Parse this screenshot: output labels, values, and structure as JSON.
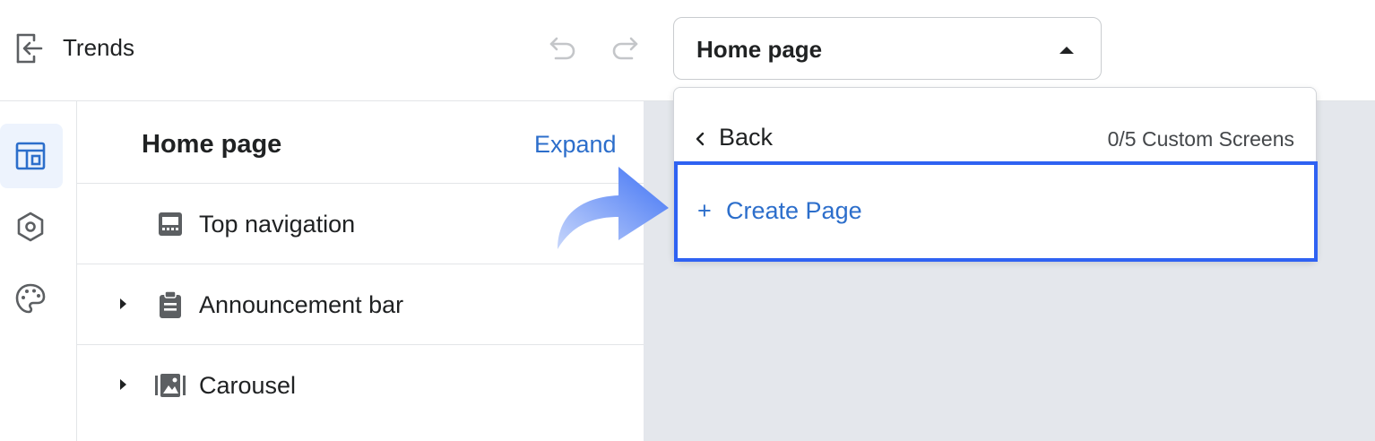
{
  "topbar": {
    "app_title": "Trends",
    "page_select": {
      "value": "Home page"
    }
  },
  "rail": {
    "items": [
      {
        "name": "layout",
        "icon": "layout-icon",
        "active": true
      },
      {
        "name": "settings",
        "icon": "gear-icon",
        "active": false
      },
      {
        "name": "theme",
        "icon": "palette-icon",
        "active": false
      }
    ]
  },
  "panel": {
    "title": "Home page",
    "expand_label": "Expand",
    "sections": [
      {
        "label": "Top navigation",
        "icon": "navigation-bar-icon",
        "has_children": false
      },
      {
        "label": "Announcement bar",
        "icon": "clipboard-icon",
        "has_children": true
      },
      {
        "label": "Carousel",
        "icon": "image-gallery-icon",
        "has_children": true
      }
    ]
  },
  "dropdown": {
    "back_label": "Back",
    "screens_count": "0/5 Custom Screens",
    "create_plus": "+",
    "create_label": "Create Page"
  },
  "colors": {
    "accent": "#2c6ecb",
    "highlight_border": "#2f62f2",
    "canvas_bg": "#e4e7ec",
    "active_rail_bg": "#edf3fd"
  }
}
